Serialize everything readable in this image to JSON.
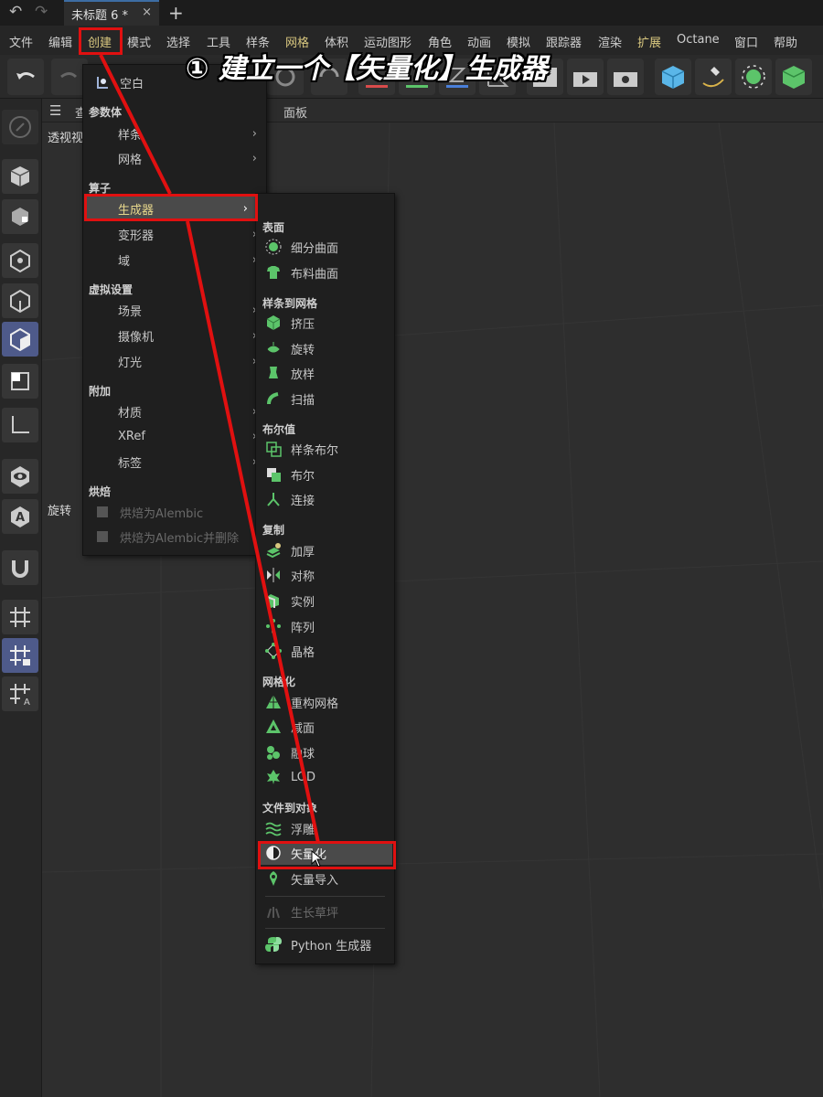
{
  "titlebar": {
    "undo_icon": "undo-arrow-icon",
    "redo_icon": "redo-arrow-icon",
    "tab_title": "未标题 6 *",
    "tab_close": "×",
    "tab_add": "+"
  },
  "menubar": {
    "items": [
      "文件",
      "编辑",
      "创建",
      "模式",
      "选择",
      "工具",
      "样条",
      "网格",
      "体积",
      "运动图形",
      "角色",
      "动画",
      "模拟",
      "跟踪器",
      "渲染",
      "扩展",
      "Octane",
      "窗口",
      "帮助"
    ]
  },
  "viewport": {
    "header_items": [
      "查",
      "面板"
    ],
    "view_name": "透视视",
    "rotate_label": "旋转"
  },
  "create_menu": {
    "items": [
      {
        "type": "item",
        "label": "空白",
        "icon": "null-object-icon"
      },
      {
        "type": "section",
        "label": "参数体"
      },
      {
        "type": "item",
        "label": "样条",
        "submenu": true
      },
      {
        "type": "item",
        "label": "网格",
        "submenu": true
      },
      {
        "type": "section",
        "label": "算子"
      },
      {
        "type": "item",
        "label": "生成器",
        "submenu": true,
        "highlighted": true
      },
      {
        "type": "item",
        "label": "变形器",
        "submenu": true
      },
      {
        "type": "item",
        "label": "域",
        "submenu": true
      },
      {
        "type": "section",
        "label": "虚拟设置"
      },
      {
        "type": "item",
        "label": "场景",
        "submenu": true
      },
      {
        "type": "item",
        "label": "摄像机",
        "submenu": true
      },
      {
        "type": "item",
        "label": "灯光",
        "submenu": true
      },
      {
        "type": "section",
        "label": "附加"
      },
      {
        "type": "item",
        "label": "材质",
        "submenu": true
      },
      {
        "type": "item",
        "label": "XRef",
        "submenu": true
      },
      {
        "type": "item",
        "label": "标签",
        "submenu": true
      },
      {
        "type": "section",
        "label": "烘焙"
      },
      {
        "type": "item",
        "label": "烘焙为Alembic",
        "disabled": true,
        "icon": "bake-icon"
      },
      {
        "type": "item",
        "label": "烘焙为Alembic并删除",
        "disabled": true,
        "icon": "bake-icon"
      }
    ]
  },
  "generator_menu": {
    "items": [
      {
        "type": "section",
        "label": "表面"
      },
      {
        "type": "item",
        "label": "细分曲面",
        "icon": "subdivision-surface-icon"
      },
      {
        "type": "item",
        "label": "布料曲面",
        "icon": "cloth-surface-icon"
      },
      {
        "type": "section",
        "label": "样条到网格"
      },
      {
        "type": "item",
        "label": "挤压",
        "icon": "extrude-icon"
      },
      {
        "type": "item",
        "label": "旋转",
        "icon": "lathe-icon"
      },
      {
        "type": "item",
        "label": "放样",
        "icon": "loft-icon"
      },
      {
        "type": "item",
        "label": "扫描",
        "icon": "sweep-icon"
      },
      {
        "type": "section",
        "label": "布尔值"
      },
      {
        "type": "item",
        "label": "样条布尔",
        "icon": "spline-boolean-icon"
      },
      {
        "type": "item",
        "label": "布尔",
        "icon": "boolean-icon"
      },
      {
        "type": "item",
        "label": "连接",
        "icon": "connect-icon"
      },
      {
        "type": "section",
        "label": "复制"
      },
      {
        "type": "item",
        "label": "加厚",
        "icon": "thicken-icon"
      },
      {
        "type": "item",
        "label": "对称",
        "icon": "symmetry-icon"
      },
      {
        "type": "item",
        "label": "实例",
        "icon": "instance-icon"
      },
      {
        "type": "item",
        "label": "阵列",
        "icon": "array-icon"
      },
      {
        "type": "item",
        "label": "晶格",
        "icon": "lattice-icon"
      },
      {
        "type": "section",
        "label": "网格化"
      },
      {
        "type": "item",
        "label": "重构网格",
        "icon": "remesh-icon"
      },
      {
        "type": "item",
        "label": "减面",
        "icon": "polygon-reduction-icon"
      },
      {
        "type": "item",
        "label": "融球",
        "icon": "metaball-icon"
      },
      {
        "type": "item",
        "label": "LOD",
        "icon": "lod-icon"
      },
      {
        "type": "section",
        "label": "文件到对象"
      },
      {
        "type": "item",
        "label": "浮雕",
        "icon": "relief-icon"
      },
      {
        "type": "item",
        "label": "矢量化",
        "icon": "vectorizer-icon",
        "highlighted": true
      },
      {
        "type": "item",
        "label": "矢量导入",
        "icon": "vector-import-icon"
      },
      {
        "type": "separator"
      },
      {
        "type": "item",
        "label": "生长草坪",
        "icon": "grass-icon",
        "disabled": true
      },
      {
        "type": "separator"
      },
      {
        "type": "item",
        "label": "Python 生成器",
        "icon": "python-icon"
      }
    ]
  },
  "annotation": {
    "text": "① 建立一个【矢量化】生成器"
  },
  "colors": {
    "annotation_red": "#e01010",
    "accent_green": "#4fc46a",
    "menu_bg": "#1f1f1f",
    "highlight": "#4a4a4a"
  }
}
